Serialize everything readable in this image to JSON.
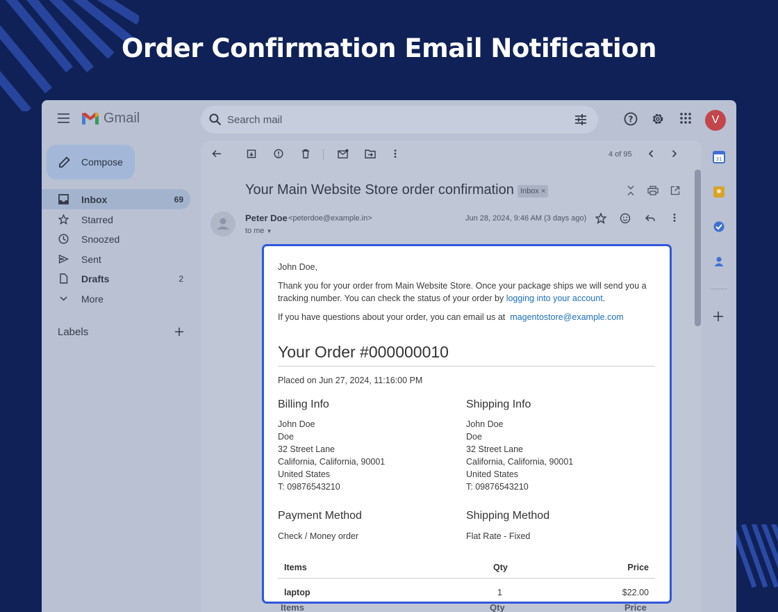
{
  "page_title": "Order Confirmation Email Notification",
  "colors": {
    "background": "#0f2156",
    "highlight": "#2f57dc",
    "link": "#1e6fb8",
    "avatar": "#c2464b"
  },
  "gmail": {
    "app_name": "Gmail",
    "search_placeholder": "Search mail",
    "avatar_letter": "V",
    "compose_label": "Compose",
    "nav": [
      {
        "label": "Inbox",
        "count": "69",
        "icon": "inbox-icon"
      },
      {
        "label": "Starred",
        "count": "",
        "icon": "star-icon"
      },
      {
        "label": "Snoozed",
        "count": "",
        "icon": "clock-icon"
      },
      {
        "label": "Sent",
        "count": "",
        "icon": "send-icon"
      },
      {
        "label": "Drafts",
        "count": "2",
        "icon": "draft-icon"
      },
      {
        "label": "More",
        "count": "",
        "icon": "chevron-down-icon"
      }
    ],
    "labels_header": "Labels",
    "pager": "4 of 95",
    "subject": "Your Main Website Store order confirmation",
    "inbox_chip": "Inbox ×",
    "sender_name": "Peter Doe",
    "sender_email": "<peterdoe@example.in>",
    "to": "to me",
    "date": "Jun 28, 2024, 9:46 AM (3 days ago)",
    "ghost_headers": {
      "items": "Items",
      "qty": "Qty",
      "price": "Price"
    }
  },
  "email": {
    "greeting": "John Doe,",
    "intro_line1": "Thank you for your order from Main Website Store. Once your package ships we will send you a",
    "intro_line2": "tracking number. You can check the status of your order by",
    "login_link": "logging into your account",
    "period": ".",
    "questions": "If you have questions about your order, you can email us at",
    "support_email": "magentostore@example.com",
    "order_title": "Your Order #000000010",
    "placed_on": "Placed on Jun 27, 2024, 11:16:00 PM",
    "billing": {
      "title": "Billing Info",
      "lines": [
        "John Doe",
        "Doe",
        "32 Street Lane",
        "California, California, 90001",
        "United States",
        "T: 09876543210"
      ]
    },
    "shipping": {
      "title": "Shipping Info",
      "lines": [
        "John Doe",
        "Doe",
        "32 Street Lane",
        "California, California, 90001",
        "United States",
        "T: 09876543210"
      ]
    },
    "payment_method": {
      "title": "Payment Method",
      "value": "Check / Money order"
    },
    "shipping_method": {
      "title": "Shipping Method",
      "value": "Flat Rate - Fixed"
    },
    "table": {
      "headers": {
        "items": "Items",
        "qty": "Qty",
        "price": "Price"
      },
      "rows": [
        {
          "item": "laptop",
          "qty": "1",
          "price": "$22.00"
        }
      ]
    }
  }
}
